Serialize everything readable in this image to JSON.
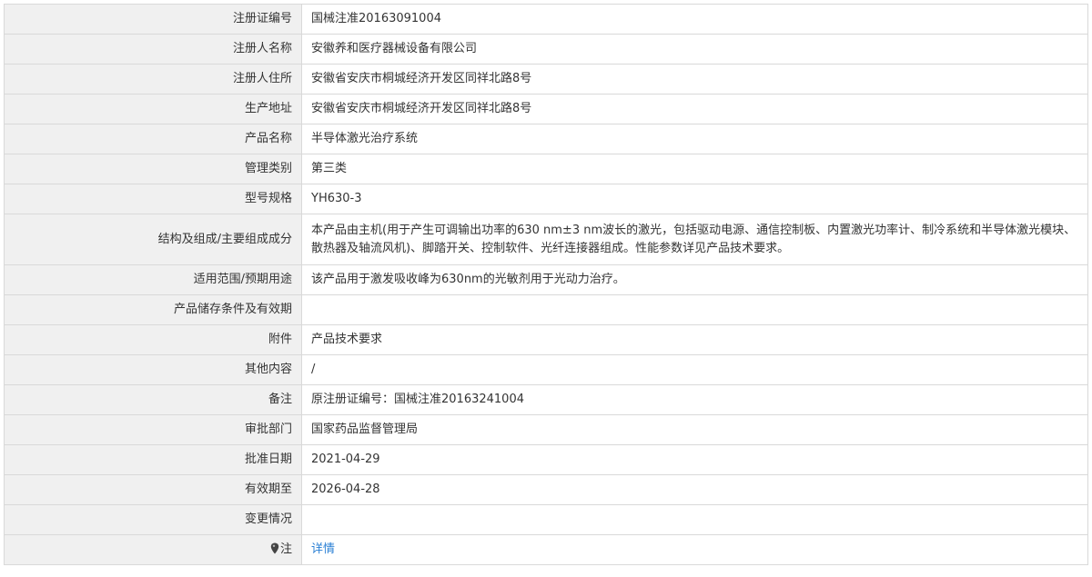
{
  "rows": [
    {
      "label": "注册证编号",
      "value": "国械注准20163091004"
    },
    {
      "label": "注册人名称",
      "value": "安徽养和医疗器械设备有限公司"
    },
    {
      "label": "注册人住所",
      "value": "安徽省安庆市桐城经济开发区同祥北路8号"
    },
    {
      "label": "生产地址",
      "value": "安徽省安庆市桐城经济开发区同祥北路8号"
    },
    {
      "label": "产品名称",
      "value": "半导体激光治疗系统"
    },
    {
      "label": "管理类别",
      "value": "第三类"
    },
    {
      "label": "型号规格",
      "value": "YH630-3"
    },
    {
      "label": "结构及组成/主要组成成分",
      "value": "本产品由主机(用于产生可调输出功率的630 nm±3 nm波长的激光，包括驱动电源、通信控制板、内置激光功率计、制冷系统和半导体激光模块、散热器及轴流风机)、脚踏开关、控制软件、光纤连接器组成。性能参数详见产品技术要求。"
    },
    {
      "label": "适用范围/预期用途",
      "value": "该产品用于激发吸收峰为630nm的光敏剂用于光动力治疗。"
    },
    {
      "label": "产品储存条件及有效期",
      "value": ""
    },
    {
      "label": "附件",
      "value": "产品技术要求"
    },
    {
      "label": "其他内容",
      "value": "/"
    },
    {
      "label": "备注",
      "value": "原注册证编号：国械注准20163241004"
    },
    {
      "label": "审批部门",
      "value": "国家药品监督管理局"
    },
    {
      "label": "批准日期",
      "value": "2021-04-29"
    },
    {
      "label": "有效期至",
      "value": "2026-04-28"
    },
    {
      "label": "变更情况",
      "value": ""
    }
  ],
  "note_row": {
    "icon": "pin-icon",
    "label": "注",
    "link_text": "详情",
    "link_color": "#2a7fd4"
  },
  "colors": {
    "label_bg": "#f0f0f0",
    "border": "#d9d9d9",
    "text": "#333333"
  }
}
